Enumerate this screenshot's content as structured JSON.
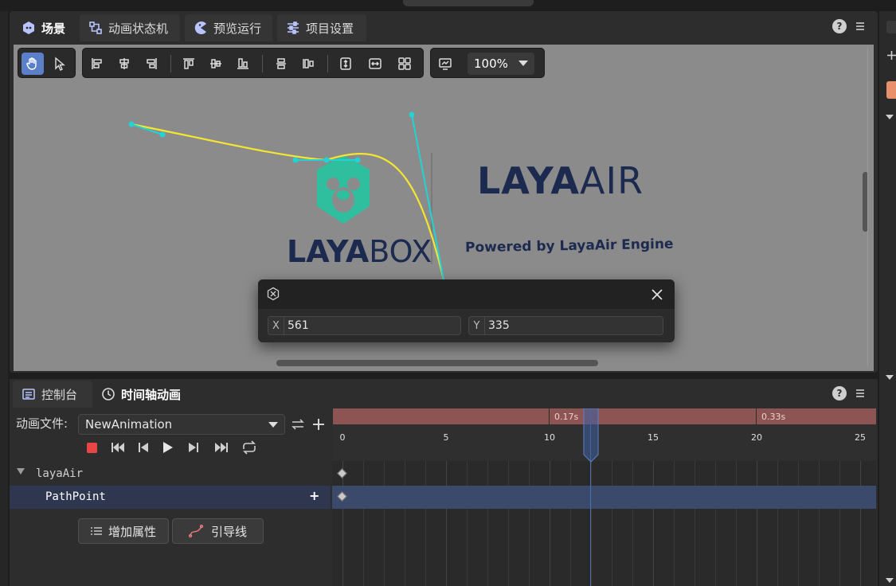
{
  "scene_tabs": [
    {
      "label": "场景",
      "icon": "laya-icon"
    },
    {
      "label": "动画状态机",
      "icon": "state-machine-icon"
    },
    {
      "label": "预览运行",
      "icon": "pacman-icon"
    },
    {
      "label": "项目设置",
      "icon": "sliders-icon"
    }
  ],
  "toolbar": {
    "zoom": "100%"
  },
  "canvas": {
    "laya_air_logo": "LAYAAIR",
    "laya_air_logo_parts": [
      "LAYA",
      "AIR"
    ],
    "powered_by": "Powered by LayaAir Engine",
    "layabox_logo": "LAYABOX",
    "layabox_logo_parts": [
      "LAYA",
      "BOX"
    ]
  },
  "coord_popup": {
    "x_label": "X",
    "x_value": "561",
    "y_label": "Y",
    "y_value": "335"
  },
  "bottom_tabs": [
    {
      "label": "控制台",
      "icon": "console-icon"
    },
    {
      "label": "时间轴动画",
      "icon": "clock-icon"
    }
  ],
  "timeline": {
    "anim_file_label": "动画文件:",
    "anim_file_value": "NewAnimation",
    "segments": [
      "0.17s",
      "0.33s"
    ],
    "ruler_numbers": [
      "0",
      "5",
      "10",
      "15",
      "20",
      "25"
    ],
    "tree": {
      "root_label": "layaAir",
      "child_label": "PathPoint",
      "add_symbol": "+"
    },
    "add_property_label": "增加属性",
    "guide_line_label": "引导线"
  },
  "colors": {
    "accent": "#5b7fc9",
    "path_curve": "#f5e533",
    "handle": "#22d3d3",
    "record": "#e84545",
    "playhead": "#4a6fb5",
    "segment": "#8d5454",
    "laya_navy": "#1c2a4f",
    "laya_teal": "#2fbf9f"
  }
}
